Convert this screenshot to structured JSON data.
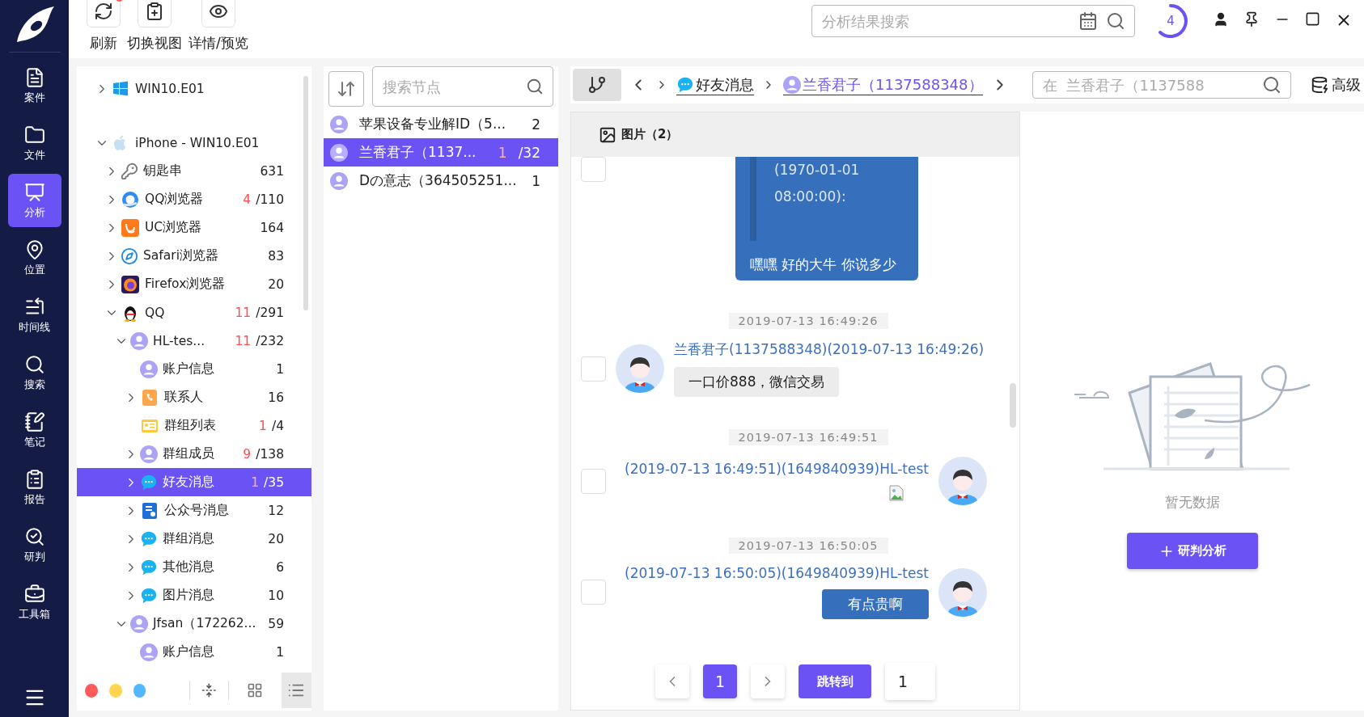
{
  "sidebar": {
    "items": [
      {
        "label": "案件",
        "kind": "case",
        "selected": false
      },
      {
        "label": "文件",
        "kind": "file",
        "selected": false
      },
      {
        "label": "分析",
        "kind": "analysis",
        "selected": true
      },
      {
        "label": "位置",
        "kind": "location",
        "selected": false
      },
      {
        "label": "时间线",
        "kind": "timeline",
        "selected": false
      },
      {
        "label": "搜索",
        "kind": "search",
        "selected": false
      },
      {
        "label": "笔记",
        "kind": "note",
        "selected": false
      },
      {
        "label": "报告",
        "kind": "report",
        "selected": false
      },
      {
        "label": "研判",
        "kind": "judge",
        "selected": false
      },
      {
        "label": "工具箱",
        "kind": "toolbox",
        "selected": false
      }
    ]
  },
  "toolbar": {
    "buttons": [
      {
        "label": "刷新",
        "kind": "refresh",
        "notification": true
      },
      {
        "label": "切换视图",
        "kind": "view",
        "notification": false
      },
      {
        "label": "详情/预览",
        "kind": "preview",
        "notification": false
      }
    ]
  },
  "global_search": {
    "placeholder": "分析结果搜索"
  },
  "task_counter": "4",
  "tree": {
    "nodes": [
      {
        "label": "WIN10.E01",
        "kind": "windows",
        "expanded": false,
        "selected": false
      },
      {
        "label": "iPhone - WIN10.E01",
        "kind": "apple",
        "expanded": true,
        "selected": false,
        "children": [
          {
            "label": "钥匙串",
            "kind": "keys",
            "expanded": false,
            "selected": false,
            "total": "631"
          },
          {
            "label": "QQ浏览器",
            "kind": "qqbrowser",
            "expanded": false,
            "selected": false,
            "alert": "4",
            "total": "/110"
          },
          {
            "label": "UC浏览器",
            "kind": "ucbrowser",
            "expanded": false,
            "selected": false,
            "total": "164"
          },
          {
            "label": "Safari浏览器",
            "kind": "safari",
            "expanded": false,
            "selected": false,
            "total": "83"
          },
          {
            "label": "Firefox浏览器",
            "kind": "firefox",
            "expanded": false,
            "selected": false,
            "total": "20"
          },
          {
            "label": "QQ",
            "kind": "qq",
            "expanded": true,
            "selected": false,
            "alert": "11",
            "total": "/291",
            "children": [
              {
                "label": "HL-tes...",
                "kind": "account",
                "expanded": true,
                "selected": false,
                "alert": "11",
                "total": "/232",
                "children": [
                  {
                    "label": "账户信息",
                    "kind": "account",
                    "selected": false,
                    "total": "1"
                  },
                  {
                    "label": "联系人",
                    "kind": "contacts",
                    "expanded": false,
                    "selected": false,
                    "total": "16"
                  },
                  {
                    "label": "群组列表",
                    "kind": "grouplist",
                    "selected": false,
                    "alert": "1",
                    "total": "/4"
                  },
                  {
                    "label": "群组成员",
                    "kind": "account",
                    "expanded": false,
                    "selected": false,
                    "alert": "9",
                    "total": "/138"
                  },
                  {
                    "label": "好友消息",
                    "kind": "chat",
                    "expanded": false,
                    "selected": true,
                    "alert": "1",
                    "total": "/35"
                  },
                  {
                    "label": "公众号消息",
                    "kind": "official",
                    "expanded": false,
                    "selected": false,
                    "total": "12"
                  },
                  {
                    "label": "群组消息",
                    "kind": "chat",
                    "expanded": false,
                    "selected": false,
                    "total": "20"
                  },
                  {
                    "label": "其他消息",
                    "kind": "chat",
                    "expanded": false,
                    "selected": false,
                    "total": "6"
                  },
                  {
                    "label": "图片消息",
                    "kind": "chat",
                    "expanded": false,
                    "selected": false,
                    "total": "10"
                  }
                ]
              },
              {
                "label": "Jfsan（172262...",
                "kind": "account",
                "expanded": true,
                "selected": false,
                "total": "59",
                "children": [
                  {
                    "label": "账户信息",
                    "kind": "account",
                    "selected": false,
                    "total": "1"
                  }
                ]
              }
            ]
          }
        ]
      }
    ],
    "color_filters": [
      {
        "color": "#ff5b5b"
      },
      {
        "color": "#ffd54f"
      },
      {
        "color": "#4fb8ff"
      }
    ],
    "view_modes": [
      {
        "kind": "grid",
        "selected": false
      },
      {
        "kind": "list",
        "selected": true
      }
    ]
  },
  "node_list": {
    "search_placeholder": "搜索节点",
    "items": [
      {
        "label": "苹果设备专业解ID（5...",
        "total": "2",
        "selected": false
      },
      {
        "label": "兰香君子（1137...",
        "alert": "1",
        "total": "/32",
        "selected": true
      },
      {
        "label": "Dの意志（364505251...",
        "total": "1",
        "selected": false
      }
    ]
  },
  "breadcrumb": [
    {
      "label": "好友消息",
      "kind": "category"
    },
    {
      "label": "兰香君子（1137588348）",
      "kind": "contact"
    }
  ],
  "chat_search": {
    "placeholder": "在  兰香君子（1137588"
  },
  "advanced_button": "高级",
  "chat": {
    "tab": "图片（2）",
    "messages": [
      {
        "kind": "quote",
        "outgoing": true,
        "quote": "(1970-01-01 08:00:00):",
        "text": "嘿嘿 好的大牛 你说多少",
        "checked": false
      },
      {
        "kind": "text",
        "outgoing": false,
        "time": "2019-07-13 16:49:26",
        "sender": "兰香君子(1137588348)(2019-07-13 16:49:26)",
        "text": "一口价888，微信交易",
        "checked": false
      },
      {
        "kind": "image",
        "outgoing": true,
        "time": "2019-07-13 16:49:51",
        "sender": "(2019-07-13 16:49:51)(1649840939)HL-test",
        "checked": false
      },
      {
        "kind": "text",
        "outgoing": true,
        "time": "2019-07-13 16:50:05",
        "sender": "(2019-07-13 16:50:05)(1649840939)HL-test",
        "text": "有点贵啊",
        "checked": false
      }
    ],
    "pagination": {
      "pages": [
        {
          "label": "1",
          "selected": true
        }
      ],
      "jump_label": "跳转到",
      "jump_value": "1"
    }
  },
  "analysis_panel": {
    "empty_text": "暂无数据",
    "button": "研判分析"
  }
}
